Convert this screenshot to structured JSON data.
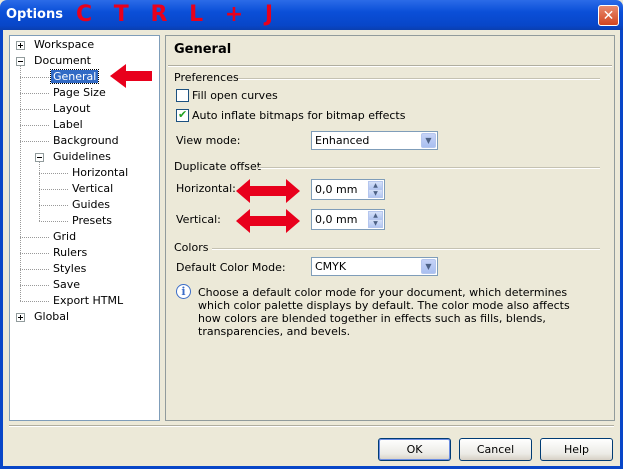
{
  "window": {
    "title": "Options",
    "shortcut_annotation": "C T R L + J",
    "close_glyph": "✕"
  },
  "tree": {
    "items": [
      {
        "label": "Workspace",
        "level": 0,
        "expander": "plus"
      },
      {
        "label": "Document",
        "level": 0,
        "expander": "minus"
      },
      {
        "label": "General",
        "level": 1,
        "selected": true
      },
      {
        "label": "Page Size",
        "level": 1
      },
      {
        "label": "Layout",
        "level": 1
      },
      {
        "label": "Label",
        "level": 1
      },
      {
        "label": "Background",
        "level": 1
      },
      {
        "label": "Guidelines",
        "level": 1,
        "expander": "minus"
      },
      {
        "label": "Horizontal",
        "level": 2
      },
      {
        "label": "Vertical",
        "level": 2
      },
      {
        "label": "Guides",
        "level": 2
      },
      {
        "label": "Presets",
        "level": 2
      },
      {
        "label": "Grid",
        "level": 1
      },
      {
        "label": "Rulers",
        "level": 1
      },
      {
        "label": "Styles",
        "level": 1
      },
      {
        "label": "Save",
        "level": 1
      },
      {
        "label": "Export HTML",
        "level": 1
      },
      {
        "label": "Global",
        "level": 0,
        "expander": "plus"
      }
    ]
  },
  "panel": {
    "title": "General",
    "preferences": {
      "heading": "Preferences",
      "fill_open_curves": {
        "label": "Fill open curves",
        "checked": false
      },
      "auto_inflate": {
        "label": "Auto inflate bitmaps for bitmap effects",
        "checked": true
      },
      "view_mode_label": "View mode:",
      "view_mode_value": "Enhanced"
    },
    "duplicate_offset": {
      "heading": "Duplicate offset",
      "horizontal_label": "Horizontal:",
      "horizontal_value": "0,0 mm",
      "vertical_label": "Vertical:",
      "vertical_value": "0,0 mm"
    },
    "colors": {
      "heading": "Colors",
      "default_mode_label": "Default Color Mode:",
      "default_mode_value": "CMYK",
      "info_text": "Choose a default color mode for your document, which determines which color palette displays by default. The color mode also affects how colors are blended together in effects such as fills, blends, transparencies, and bevels."
    }
  },
  "buttons": {
    "ok": "OK",
    "cancel": "Cancel",
    "help": "Help"
  },
  "colors": {
    "titlebar": "#0a4fd8",
    "annotation_red": "#e8001c",
    "selection": "#316ac5",
    "dialog_bg": "#ece9d8"
  }
}
